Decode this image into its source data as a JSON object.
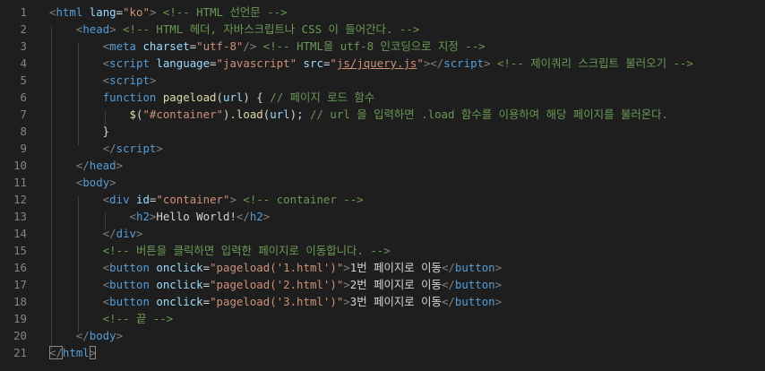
{
  "editor": {
    "line_numbers": [
      "1",
      "2",
      "3",
      "4",
      "5",
      "6",
      "7",
      "8",
      "9",
      "10",
      "11",
      "12",
      "13",
      "14",
      "15",
      "16",
      "17",
      "18",
      "19",
      "20",
      "21"
    ],
    "lines": [
      [
        {
          "c": "punc",
          "t": "<"
        },
        {
          "c": "tag",
          "t": "html"
        },
        {
          "c": "text",
          "t": " "
        },
        {
          "c": "attr",
          "t": "lang"
        },
        {
          "c": "text",
          "t": "="
        },
        {
          "c": "str",
          "t": "\"ko\""
        },
        {
          "c": "punc",
          "t": ">"
        },
        {
          "c": "text",
          "t": " "
        },
        {
          "c": "com",
          "t": "<!-- HTML 선언문 -->"
        }
      ],
      [
        {
          "c": "text",
          "t": "    "
        },
        {
          "c": "punc",
          "t": "<"
        },
        {
          "c": "tag",
          "t": "head"
        },
        {
          "c": "punc",
          "t": ">"
        },
        {
          "c": "text",
          "t": " "
        },
        {
          "c": "com",
          "t": "<!-- HTML 헤더, 자바스크립트나 CSS 이 들어간다. -->"
        }
      ],
      [
        {
          "c": "text",
          "t": "        "
        },
        {
          "c": "punc",
          "t": "<"
        },
        {
          "c": "tag",
          "t": "meta"
        },
        {
          "c": "text",
          "t": " "
        },
        {
          "c": "attr",
          "t": "charset"
        },
        {
          "c": "text",
          "t": "="
        },
        {
          "c": "str",
          "t": "\"utf-8\""
        },
        {
          "c": "punc",
          "t": "/>"
        },
        {
          "c": "text",
          "t": " "
        },
        {
          "c": "com",
          "t": "<!-- HTML을 utf-8 인코딩으로 지정 -->"
        }
      ],
      [
        {
          "c": "text",
          "t": "        "
        },
        {
          "c": "punc",
          "t": "<"
        },
        {
          "c": "tag",
          "t": "script"
        },
        {
          "c": "text",
          "t": " "
        },
        {
          "c": "attr",
          "t": "language"
        },
        {
          "c": "text",
          "t": "="
        },
        {
          "c": "str",
          "t": "\"javascript\""
        },
        {
          "c": "text",
          "t": " "
        },
        {
          "c": "attr",
          "t": "src"
        },
        {
          "c": "text",
          "t": "="
        },
        {
          "c": "str",
          "t": "\""
        },
        {
          "c": "link",
          "t": "js/jquery.js"
        },
        {
          "c": "str",
          "t": "\""
        },
        {
          "c": "punc",
          "t": "></"
        },
        {
          "c": "tag",
          "t": "script"
        },
        {
          "c": "punc",
          "t": ">"
        },
        {
          "c": "text",
          "t": " "
        },
        {
          "c": "com",
          "t": "<!-- 제이쿼리 스크립트 불러오기 -->"
        }
      ],
      [
        {
          "c": "text",
          "t": "        "
        },
        {
          "c": "punc",
          "t": "<"
        },
        {
          "c": "tag",
          "t": "script"
        },
        {
          "c": "punc",
          "t": ">"
        }
      ],
      [
        {
          "c": "text",
          "t": "        "
        },
        {
          "c": "kw",
          "t": "function"
        },
        {
          "c": "text",
          "t": " "
        },
        {
          "c": "func",
          "t": "pageload"
        },
        {
          "c": "text",
          "t": "("
        },
        {
          "c": "attr",
          "t": "url"
        },
        {
          "c": "text",
          "t": ") { "
        },
        {
          "c": "com",
          "t": "// 페이지 로드 함수"
        }
      ],
      [
        {
          "c": "text",
          "t": "            "
        },
        {
          "c": "func",
          "t": "$"
        },
        {
          "c": "text",
          "t": "("
        },
        {
          "c": "str",
          "t": "\"#container\""
        },
        {
          "c": "text",
          "t": ")."
        },
        {
          "c": "func",
          "t": "load"
        },
        {
          "c": "text",
          "t": "("
        },
        {
          "c": "attr",
          "t": "url"
        },
        {
          "c": "text",
          "t": "); "
        },
        {
          "c": "com",
          "t": "// url 을 입력하면 .load 함수를 이용하여 해당 페이지를 불러온다."
        }
      ],
      [
        {
          "c": "text",
          "t": "        }"
        }
      ],
      [
        {
          "c": "text",
          "t": "        "
        },
        {
          "c": "punc",
          "t": "</"
        },
        {
          "c": "tag",
          "t": "script"
        },
        {
          "c": "punc",
          "t": ">"
        }
      ],
      [
        {
          "c": "text",
          "t": "    "
        },
        {
          "c": "punc",
          "t": "</"
        },
        {
          "c": "tag",
          "t": "head"
        },
        {
          "c": "punc",
          "t": ">"
        }
      ],
      [
        {
          "c": "text",
          "t": "    "
        },
        {
          "c": "punc",
          "t": "<"
        },
        {
          "c": "tag",
          "t": "body"
        },
        {
          "c": "punc",
          "t": ">"
        }
      ],
      [
        {
          "c": "text",
          "t": "        "
        },
        {
          "c": "punc",
          "t": "<"
        },
        {
          "c": "tag",
          "t": "div"
        },
        {
          "c": "text",
          "t": " "
        },
        {
          "c": "attr",
          "t": "id"
        },
        {
          "c": "text",
          "t": "="
        },
        {
          "c": "str",
          "t": "\"container\""
        },
        {
          "c": "punc",
          "t": ">"
        },
        {
          "c": "text",
          "t": " "
        },
        {
          "c": "com",
          "t": "<!-- container -->"
        }
      ],
      [
        {
          "c": "text",
          "t": "            "
        },
        {
          "c": "punc",
          "t": "<"
        },
        {
          "c": "tag",
          "t": "h2"
        },
        {
          "c": "punc",
          "t": ">"
        },
        {
          "c": "text",
          "t": "Hello World!"
        },
        {
          "c": "punc",
          "t": "</"
        },
        {
          "c": "tag",
          "t": "h2"
        },
        {
          "c": "punc",
          "t": ">"
        }
      ],
      [
        {
          "c": "text",
          "t": "        "
        },
        {
          "c": "punc",
          "t": "</"
        },
        {
          "c": "tag",
          "t": "div"
        },
        {
          "c": "punc",
          "t": ">"
        }
      ],
      [
        {
          "c": "text",
          "t": "        "
        },
        {
          "c": "com",
          "t": "<!-- 버튼을 클릭하면 입력한 페이지로 이동합니다. -->"
        }
      ],
      [
        {
          "c": "text",
          "t": "        "
        },
        {
          "c": "punc",
          "t": "<"
        },
        {
          "c": "tag",
          "t": "button"
        },
        {
          "c": "text",
          "t": " "
        },
        {
          "c": "attr",
          "t": "onclick"
        },
        {
          "c": "text",
          "t": "="
        },
        {
          "c": "str",
          "t": "\"pageload('1.html')\""
        },
        {
          "c": "punc",
          "t": ">"
        },
        {
          "c": "text",
          "t": "1번 페이지로 이동"
        },
        {
          "c": "punc",
          "t": "</"
        },
        {
          "c": "tag",
          "t": "button"
        },
        {
          "c": "punc",
          "t": ">"
        }
      ],
      [
        {
          "c": "text",
          "t": "        "
        },
        {
          "c": "punc",
          "t": "<"
        },
        {
          "c": "tag",
          "t": "button"
        },
        {
          "c": "text",
          "t": " "
        },
        {
          "c": "attr",
          "t": "onclick"
        },
        {
          "c": "text",
          "t": "="
        },
        {
          "c": "str",
          "t": "\"pageload('2.html')\""
        },
        {
          "c": "punc",
          "t": ">"
        },
        {
          "c": "text",
          "t": "2번 페이지로 이동"
        },
        {
          "c": "punc",
          "t": "</"
        },
        {
          "c": "tag",
          "t": "button"
        },
        {
          "c": "punc",
          "t": ">"
        }
      ],
      [
        {
          "c": "text",
          "t": "        "
        },
        {
          "c": "punc",
          "t": "<"
        },
        {
          "c": "tag",
          "t": "button"
        },
        {
          "c": "text",
          "t": " "
        },
        {
          "c": "attr",
          "t": "onclick"
        },
        {
          "c": "text",
          "t": "="
        },
        {
          "c": "str",
          "t": "\"pageload('3.html')\""
        },
        {
          "c": "punc",
          "t": ">"
        },
        {
          "c": "text",
          "t": "3번 페이지로 이동"
        },
        {
          "c": "punc",
          "t": "</"
        },
        {
          "c": "tag",
          "t": "button"
        },
        {
          "c": "punc",
          "t": ">"
        }
      ],
      [
        {
          "c": "text",
          "t": "        "
        },
        {
          "c": "com",
          "t": "<!-- 끝 -->"
        }
      ],
      [
        {
          "c": "text",
          "t": "    "
        },
        {
          "c": "punc",
          "t": "</"
        },
        {
          "c": "tag",
          "t": "body"
        },
        {
          "c": "punc",
          "t": ">"
        }
      ],
      [
        {
          "c": "punc",
          "t": "</"
        },
        {
          "c": "tag",
          "t": "html"
        },
        {
          "c": "punc",
          "t": ">"
        }
      ]
    ],
    "colors": {
      "background": "#1e1e1e",
      "line_number": "#858585",
      "tag": "#569cd6",
      "attribute": "#9cdcfe",
      "string": "#ce9178",
      "comment": "#6a9955",
      "function": "#dcdcaa",
      "text": "#d4d4d4",
      "punctuation": "#808080"
    }
  }
}
